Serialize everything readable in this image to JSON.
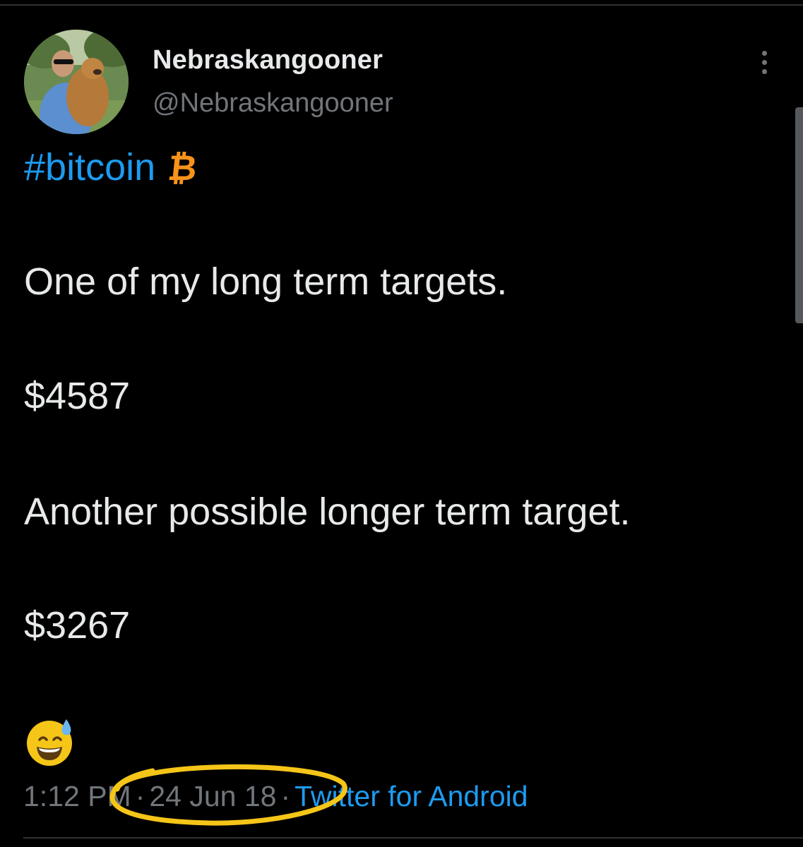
{
  "tweet": {
    "author": {
      "display_name": "Nebraskangooner",
      "handle": "@Nebraskangooner"
    },
    "hashtag": "#bitcoin",
    "bitcoin_symbol": "₿",
    "lines": [
      "One of my long term targets.",
      "$4587",
      "Another possible longer term target.",
      "$3267"
    ],
    "emoji": "grinning-face-with-sweat",
    "time": "1:12 PM",
    "separator": "·",
    "date": "24 Jun 18",
    "source": "Twitter for Android"
  },
  "icons": {
    "more": "more-vertical-icon",
    "emoji": "grinning-face-with-sweat-icon"
  },
  "colors": {
    "background": "#000000",
    "text": "#e7e9ea",
    "secondary": "#71767b",
    "link": "#1d9bf0",
    "bitcoin": "#f7931a",
    "highlight": "#f5c518"
  }
}
